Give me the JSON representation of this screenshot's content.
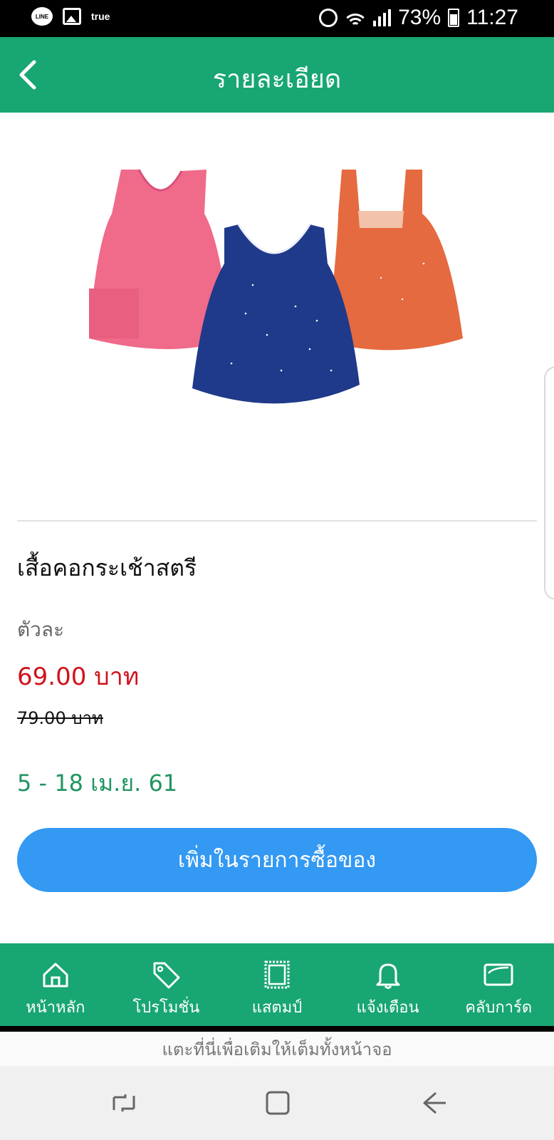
{
  "status_bar": {
    "line_icon_text": "LINE",
    "carrier_text": "true",
    "battery": "73%",
    "time": "11:27",
    "icons": [
      "line-icon",
      "gallery-icon",
      "alarm-icon",
      "wifi-icon",
      "signal-icon",
      "battery-icon"
    ]
  },
  "header": {
    "title": "รายละเอียด",
    "back_icon": "chevron-left-icon",
    "color": "#18a673"
  },
  "product": {
    "image": "three-girls-sleeveless-tops",
    "name": "เสื้อคอกระเช้าสตรี",
    "unit_label": "ตัวละ",
    "price": "69.00 บาท",
    "old_price": "79.00 บาท",
    "date_range": "5 - 18 เม.ย. 61",
    "price_color": "#d0121b",
    "date_color": "#219560"
  },
  "actions": {
    "add_to_list_label": "เพิ่มในรายการซื้อของ",
    "button_color": "#3399f3"
  },
  "bottom_nav": {
    "items": [
      {
        "label": "หน้าหลัก",
        "icon": "home-icon"
      },
      {
        "label": "โปรโมชั่น",
        "icon": "tag-icon"
      },
      {
        "label": "แสตมป์",
        "icon": "stamp-icon"
      },
      {
        "label": "แจ้งเตือน",
        "icon": "bell-icon"
      },
      {
        "label": "คลับการ์ด",
        "icon": "card-icon"
      }
    ]
  },
  "fullscreen_hint": "แตะที่นี่เพื่อเติมให้เต็มทั้งหน้าจอ",
  "system_nav": {
    "icons": [
      "recent-apps-icon",
      "home-square-icon",
      "back-arrow-icon"
    ]
  }
}
